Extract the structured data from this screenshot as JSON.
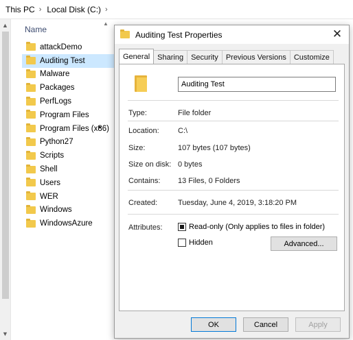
{
  "breadcrumb": {
    "items": [
      "This PC",
      "Local Disk (C:)"
    ],
    "separator": "›"
  },
  "explorer": {
    "column_header": "Name",
    "selected_index": 1,
    "files": [
      "attackDemo",
      "Auditing Test",
      "Malware",
      "Packages",
      "PerfLogs",
      "Program Files",
      "Program Files (x86)",
      "Python27",
      "Scripts",
      "Shell",
      "Users",
      "WER",
      "Windows",
      "WindowsAzure"
    ]
  },
  "dialog": {
    "title": "Auditing Test Properties",
    "close_glyph": "✕",
    "tabs": [
      "General",
      "Sharing",
      "Security",
      "Previous Versions",
      "Customize"
    ],
    "active_tab": "General",
    "name_value": "Auditing Test",
    "props": {
      "type_label": "Type:",
      "type_value": "File folder",
      "location_label": "Location:",
      "location_value": "C:\\",
      "size_label": "Size:",
      "size_value": "107 bytes (107 bytes)",
      "size_on_disk_label": "Size on disk:",
      "size_on_disk_value": "0 bytes",
      "contains_label": "Contains:",
      "contains_value": "13 Files, 0 Folders",
      "created_label": "Created:",
      "created_value": "Tuesday, June 4, 2019, 3:18:20 PM",
      "attributes_label": "Attributes:",
      "readonly_label": "Read-only (Only applies to files in folder)",
      "hidden_label": "Hidden",
      "advanced_label": "Advanced..."
    },
    "buttons": {
      "ok": "OK",
      "cancel": "Cancel",
      "apply": "Apply"
    }
  },
  "colors": {
    "selection": "#cce8ff",
    "folder": "#f2c94c",
    "accent": "#0078d7"
  }
}
